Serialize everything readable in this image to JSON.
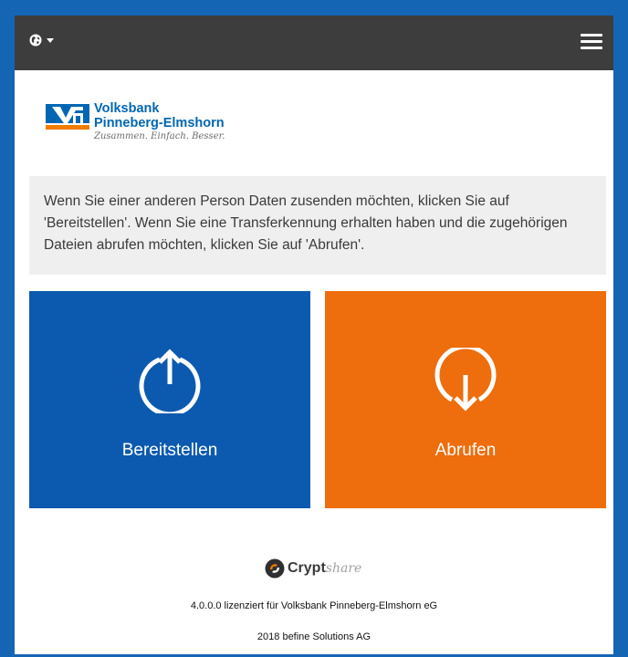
{
  "colors": {
    "page_border": "#1565b5",
    "topbar": "#3d3d3d",
    "provide_tile": "#0c5ab0",
    "fetch_tile": "#ee6d0d",
    "info_bg": "#efefef",
    "brand_blue": "#0066b3",
    "brand_orange": "#f07c00"
  },
  "topbar": {
    "language_icon": "globe-icon",
    "caret_icon": "caret-down-icon",
    "menu_icon": "hamburger-menu-icon"
  },
  "bank_logo": {
    "name_line1": "Volksbank",
    "name_line2": "Pinneberg-Elmshorn",
    "slogan": "Zusammen. Einfach. Besser."
  },
  "info_text": "Wenn Sie einer anderen Person Daten zusenden möchten, klicken Sie auf 'Bereitstellen'. Wenn Sie eine Transferkennung erhalten haben und die zugehörigen Dateien abrufen möchten, klicken Sie auf 'Abrufen'.",
  "actions": {
    "provide": {
      "label": "Bereitstellen",
      "icon": "upload-arrow-icon"
    },
    "fetch": {
      "label": "Abrufen",
      "icon": "download-arrow-icon"
    }
  },
  "footer": {
    "product_brand": "Crypt",
    "product_brand_suffix": "share",
    "license_text": "4.0.0.0 lizenziert für Volksbank Pinneberg-Elmshorn eG",
    "copyright_text": "2018 befine Solutions AG"
  }
}
